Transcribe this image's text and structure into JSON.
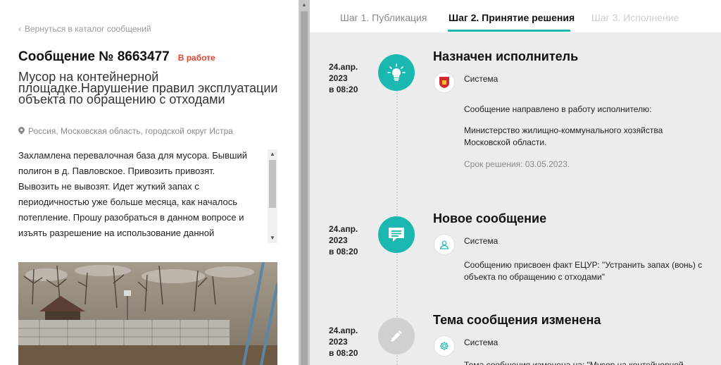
{
  "left": {
    "back_link": "Вернуться в каталог сообщений",
    "message_title": "Сообщение № 8663477",
    "status": "В работе",
    "subject": "Мусор на контейнерной площадке.Нарушение правил эксплуатации объекта по обращению с отходами",
    "location": "Россия, Московская область, городской округ Истра",
    "description": "Захламлена перевалочная база для мусора. Бывший полигон в д. Павловское. Привозить привозят. Вывозить не вывозят. Идет жуткий запах с периодичностью уже больше месяца, как началось потепление. Прошу разобраться в данном вопросе и изъять разрешение на использование данной"
  },
  "tabs": [
    {
      "label": "Шаг 1. Публикация",
      "state": "normal"
    },
    {
      "label": "Шаг 2. Принятие решения",
      "state": "active"
    },
    {
      "label": "Шаг 3. Исполнение",
      "state": "disabled"
    }
  ],
  "events": [
    {
      "date_line1": "24.апр.",
      "date_line2": "2023",
      "date_line3": "в 08:20",
      "icon": "lightbulb-icon",
      "title": "Назначен исполнитель",
      "author": "Система",
      "text1": "Сообщение направлено в работу исполнителю:",
      "text2": "Министерство жилищно-коммунального хозяйства Московской области.",
      "text3": "Срок решения: 03.05.2023."
    },
    {
      "date_line1": "24.апр.",
      "date_line2": "2023",
      "date_line3": "в 08:20",
      "icon": "chat-icon",
      "title": "Новое сообщение",
      "author": "Система",
      "text1": "Сообщению присвоен факт ЕЦУР: \"Устранить запах (вонь) с объекта по обращению с отходами\""
    },
    {
      "date_line1": "24.апр.",
      "date_line2": "2023",
      "date_line3": "в 08:20",
      "icon": "pencil-icon",
      "title": "Тема сообщения изменена",
      "author": "Система",
      "text1": "Тема сообщения изменена на: \"Мусор на контейнерной"
    }
  ],
  "colors": {
    "accent": "#1ab8b0",
    "status": "#e0462f"
  }
}
